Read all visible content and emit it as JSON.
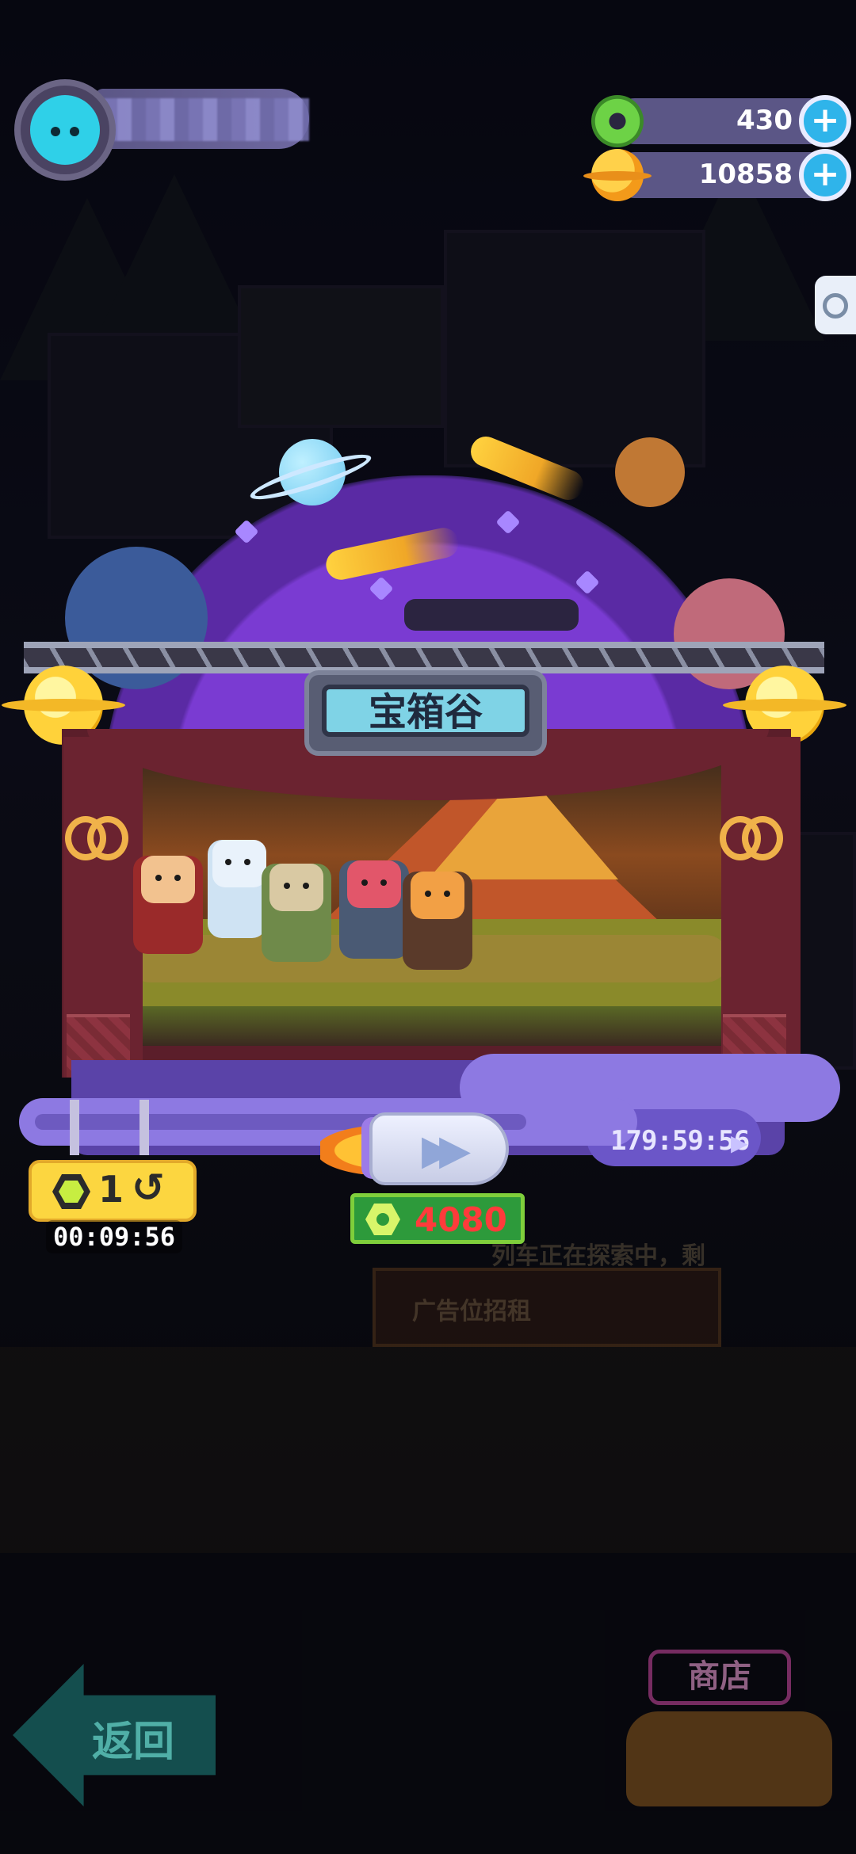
{
  "colors": {
    "dome_purple": "#7a3bd2",
    "curtain_red": "#6b2330",
    "sign_cyan": "#7fd3e6",
    "cost_red": "#ff3b3b",
    "cost_green": "#2d9a3b",
    "retry_yellow": "#fcd640",
    "plus_blue": "#2fb4ea"
  },
  "header": {
    "avatar_icon": "cat-face-icon",
    "username": ""
  },
  "currencies": [
    {
      "icon": "green-donut-icon",
      "value": "430",
      "add_label": "+"
    },
    {
      "icon": "golden-planet-icon",
      "value": "10858",
      "add_label": "+"
    }
  ],
  "stage": {
    "title": "宝箱谷",
    "countdown": "179:59:56",
    "fast_forward_icon": "fast-forward-icon"
  },
  "cost_button": {
    "icon": "hex-nut-icon",
    "value": "4080"
  },
  "retry_button": {
    "icon": "hex-nut-icon",
    "count": "1",
    "arrow": "↺",
    "timer": "00:09:56"
  },
  "background_text": {
    "exploring": "列车正在探索中，剩",
    "ad_board": "广告位招租"
  },
  "bottom": {
    "back_label": "返回",
    "shop_label": "商店"
  }
}
